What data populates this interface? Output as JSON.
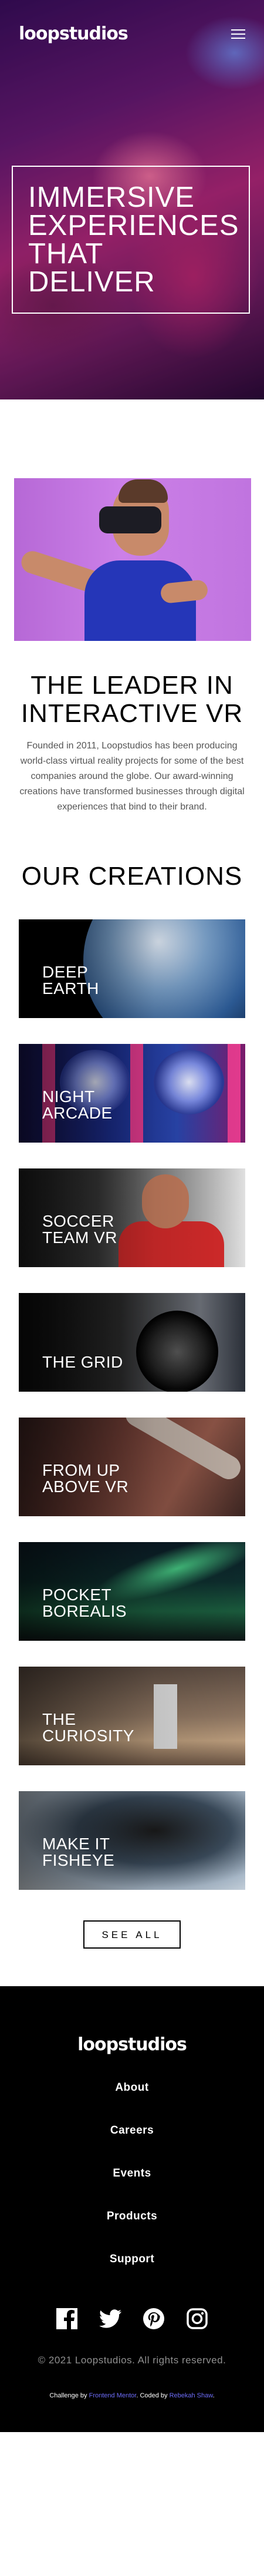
{
  "header": {
    "logo": "loopstudios",
    "menu_icon": "hamburger-menu-icon",
    "hero_title": "IMMERSIVE EXPERIENCES THAT DELIVER"
  },
  "about": {
    "title": "THE LEADER IN INTERACTIVE VR",
    "text": "Founded in 2011, Loopstudios has been producing world-class virtual reality projects for some of the best companies around the globe. Our award-winning creations have transformed businesses through digital experiences that bind to their brand."
  },
  "creations": {
    "title": "OUR CREATIONS",
    "items": [
      {
        "label": "DEEP\nEARTH"
      },
      {
        "label": "NIGHT\nARCADE"
      },
      {
        "label": "SOCCER\nTEAM VR"
      },
      {
        "label": "THE GRID"
      },
      {
        "label": "FROM UP\nABOVE VR"
      },
      {
        "label": "POCKET\nBOREALIS"
      },
      {
        "label": "THE\nCURIOSITY"
      },
      {
        "label": "MAKE IT\nFISHEYE"
      }
    ],
    "see_all": "SEE ALL"
  },
  "footer": {
    "logo": "loopstudios",
    "nav": [
      "About",
      "Careers",
      "Events",
      "Products",
      "Support"
    ],
    "socials": [
      "facebook-icon",
      "twitter-icon",
      "pinterest-icon",
      "instagram-icon"
    ],
    "copyright": "© 2021 Loopstudios. All rights reserved.",
    "credit": {
      "prefix": "Challenge by",
      "challenge_link": "Frontend Mentor",
      "middle": ". Coded by",
      "author_link": "Rebekah Shaw",
      "suffix": "."
    }
  },
  "colors": {
    "black": "#000000",
    "gray_text": "#555555",
    "credit_link": "#6d6cf8"
  }
}
